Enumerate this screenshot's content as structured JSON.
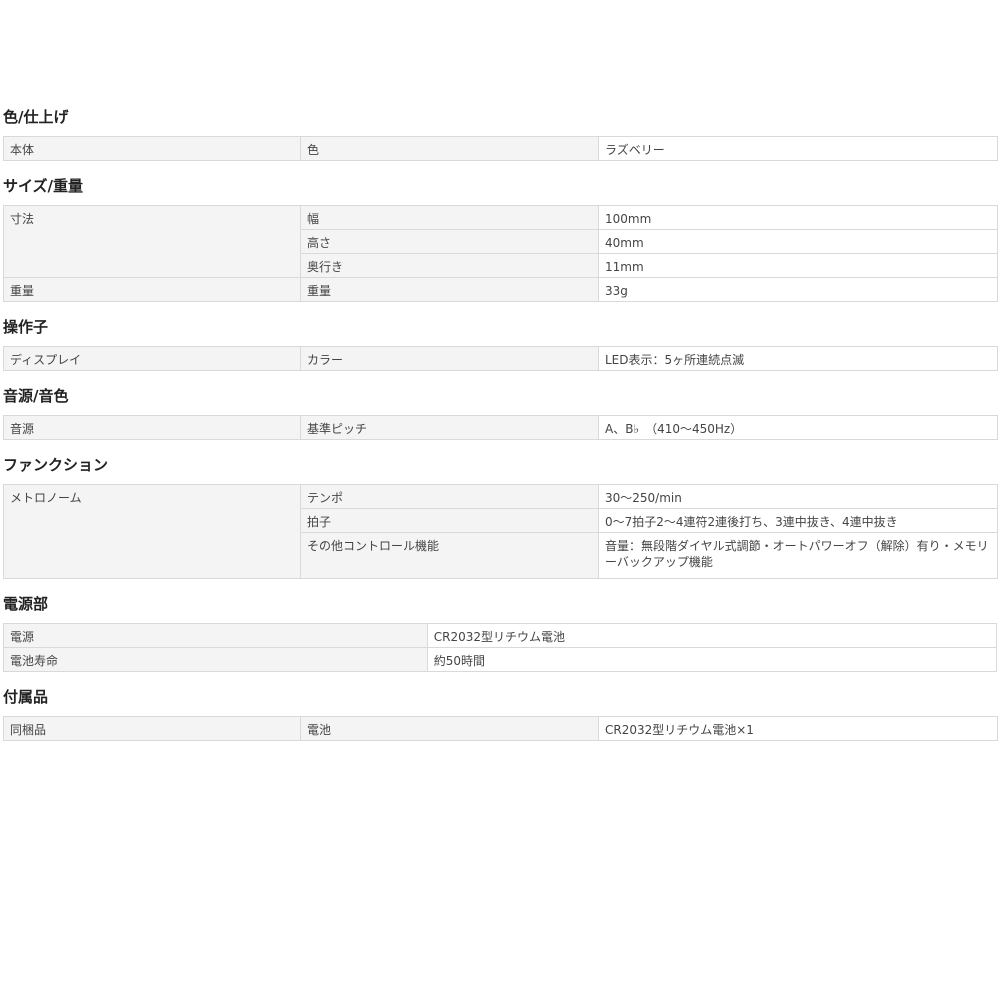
{
  "sections": [
    {
      "title": "色/仕上げ",
      "rows": [
        {
          "group": "本体",
          "label": "色",
          "value": "ラズベリー"
        }
      ]
    },
    {
      "title": "サイズ/重量",
      "rows": [
        {
          "group": "寸法",
          "label": "幅",
          "value": "100mm",
          "rowspan": 3
        },
        {
          "label": "高さ",
          "value": "40mm"
        },
        {
          "label": "奥行き",
          "value": "11mm"
        },
        {
          "group": "重量",
          "label": "重量",
          "value": "33g"
        }
      ]
    },
    {
      "title": "操作子",
      "rows": [
        {
          "group": "ディスプレイ",
          "label": "カラー",
          "value": "LED表示：5ヶ所連続点滅"
        }
      ]
    },
    {
      "title": "音源/音色",
      "rows": [
        {
          "group": "音源",
          "label": "基準ピッチ",
          "value": "A、B♭　（410〜450Hz）"
        }
      ]
    },
    {
      "title": "ファンクション",
      "rows": [
        {
          "group": "メトロノーム",
          "label": "テンポ",
          "value": "30〜250/min",
          "rowspan": 3
        },
        {
          "label": "拍子",
          "value": "0〜7拍子2〜4連符2連後打ち、3連中抜き、4連中抜き"
        },
        {
          "label": "その他コントロール機能",
          "value": "音量：無段階ダイヤル式調節・オートパワーオフ（解除）有り・メモリーバックアップ機能",
          "tall": true
        }
      ]
    },
    {
      "title": "電源部",
      "rows": [
        {
          "group": "電源",
          "value2": "CR2032型リチウム電池"
        },
        {
          "group": "電池寿命",
          "value2": "約50時間"
        }
      ]
    },
    {
      "title": "付属品",
      "rows": [
        {
          "group": "同梱品",
          "label": "電池",
          "value": "CR2032型リチウム電池×1"
        }
      ]
    }
  ]
}
